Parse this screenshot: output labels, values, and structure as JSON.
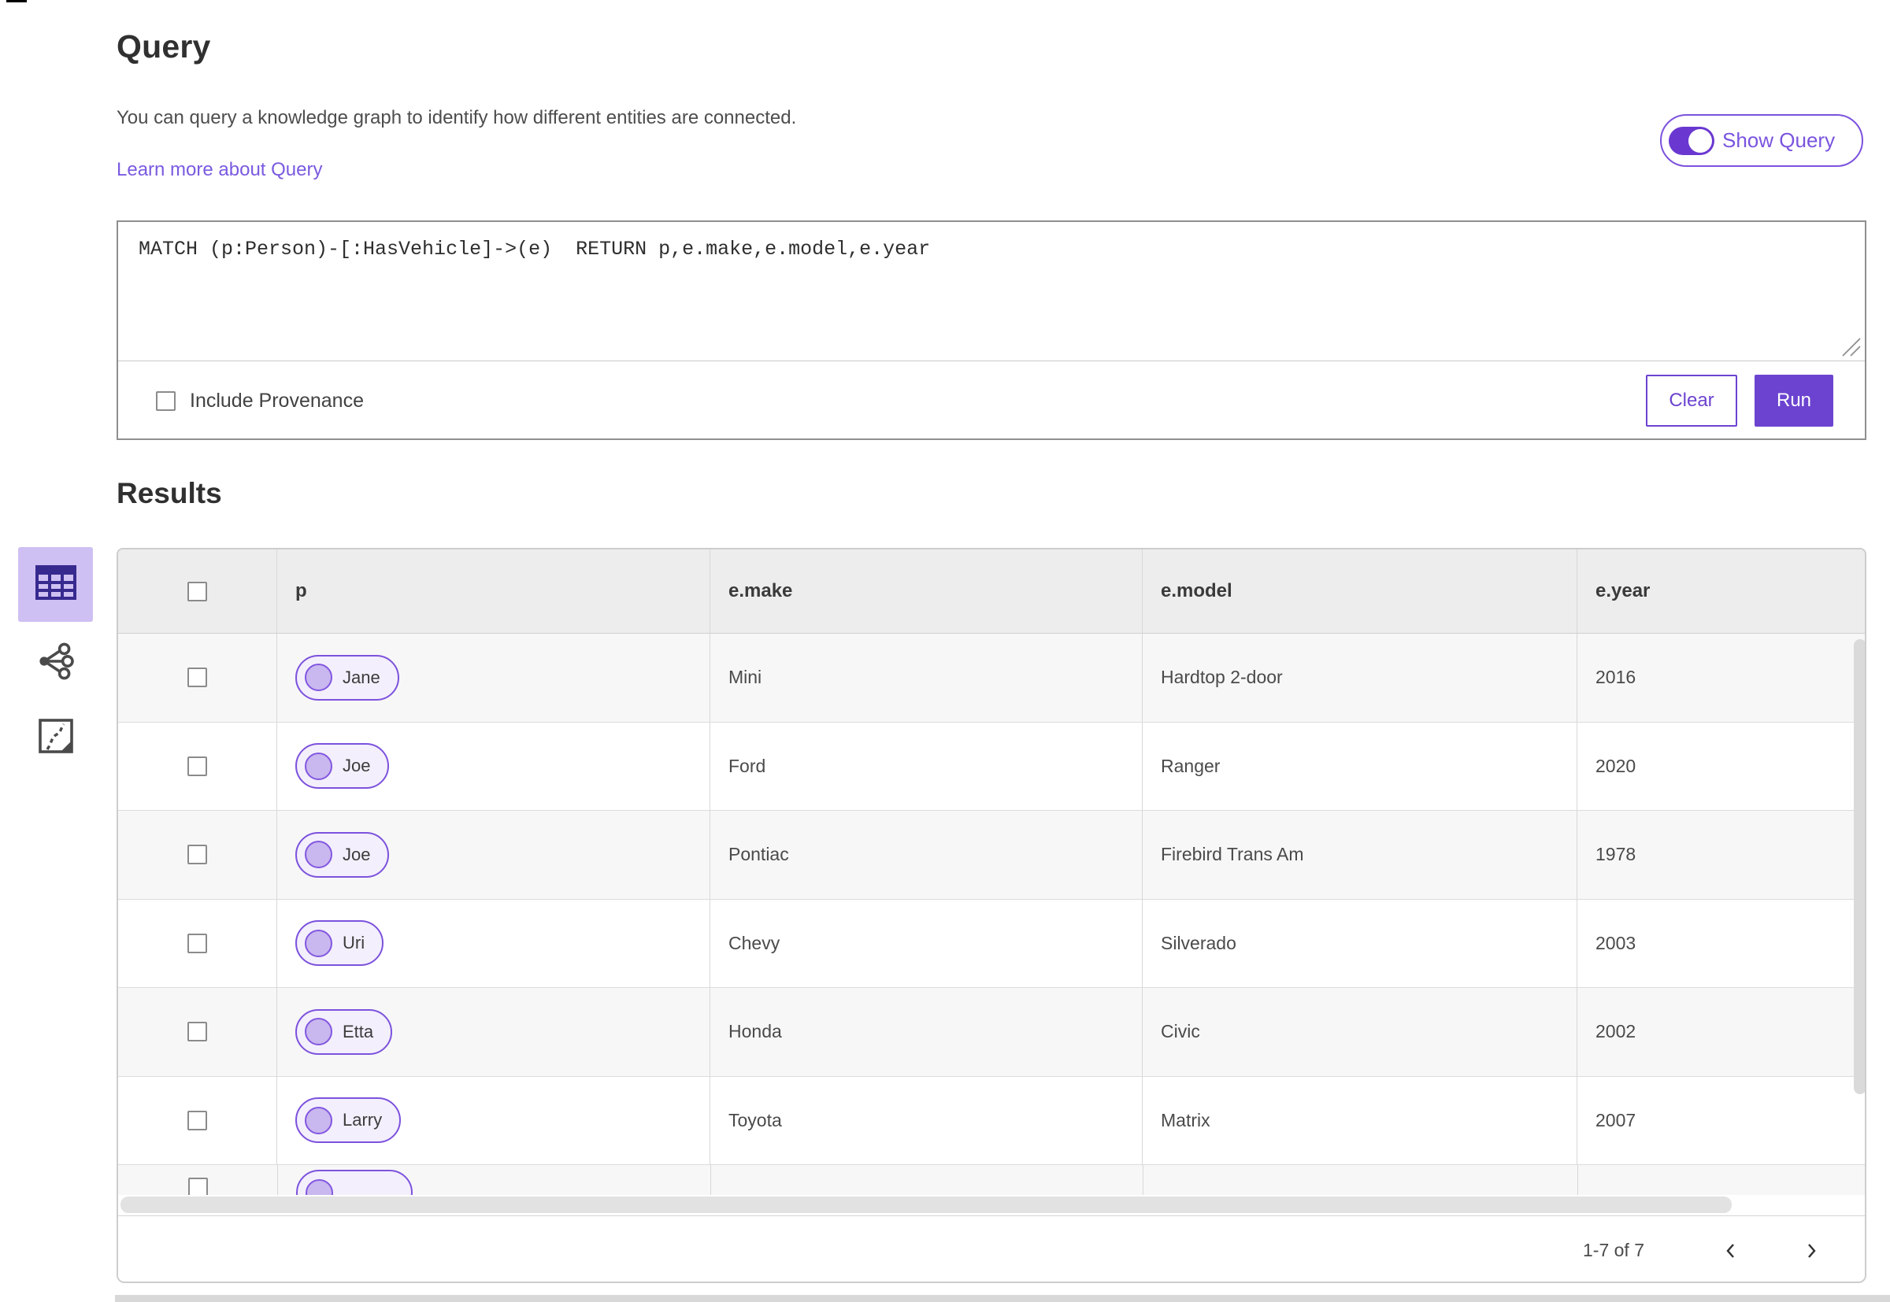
{
  "query_section": {
    "title": "Query",
    "description": "You can query a knowledge graph to identify how different entities are connected.",
    "learn_more_link": "Learn more about Query",
    "show_query_label": "Show Query",
    "show_query_on": true,
    "query_text": "MATCH (p:Person)-[:HasVehicle]->(e)  RETURN p,e.make,e.model,e.year",
    "include_provenance_label": "Include Provenance",
    "include_provenance_checked": false,
    "clear_label": "Clear",
    "run_label": "Run"
  },
  "results_section": {
    "title": "Results",
    "view_switcher": {
      "views": [
        "table-view",
        "link-chart-view",
        "map-view"
      ],
      "selected": "table-view"
    },
    "table": {
      "columns": [
        "p",
        "e.make",
        "e.model",
        "e.year"
      ],
      "rows": [
        {
          "p": "Jane",
          "make": "Mini",
          "model": "Hardtop 2-door",
          "year": "2016"
        },
        {
          "p": "Joe",
          "make": "Ford",
          "model": "Ranger",
          "year": "2020"
        },
        {
          "p": "Joe",
          "make": "Pontiac",
          "model": "Firebird Trans Am",
          "year": "1978"
        },
        {
          "p": "Uri",
          "make": "Chevy",
          "model": "Silverado",
          "year": "2003"
        },
        {
          "p": "Etta",
          "make": "Honda",
          "model": "Civic",
          "year": "2002"
        },
        {
          "p": "Larry",
          "make": "Toyota",
          "model": "Matrix",
          "year": "2007"
        }
      ],
      "partial_seventh_row_visible": true
    },
    "pagination": {
      "range_text": "1-7 of 7"
    }
  },
  "colors": {
    "accent_purple": "#6c43d0",
    "toggle_track": "#6a38d0",
    "pill_border": "#7c52dd",
    "pill_background": "#f3effc",
    "pill_dot": "#c9b7ef",
    "link_purple": "#7a5ae0",
    "selected_tile": "#cfc0f3",
    "header_background": "#ededed",
    "row_alt_background": "#f7f7f7",
    "border_gray": "#d8d8d8"
  }
}
